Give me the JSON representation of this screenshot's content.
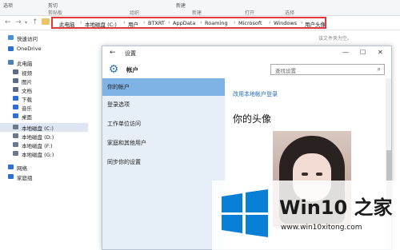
{
  "ribbon": {
    "items": [
      "选项",
      "剪切",
      "组织",
      "新建",
      "打开",
      "选择"
    ],
    "labels": [
      "剪贴板",
      "组织",
      "新建",
      "打开",
      "选择"
    ]
  },
  "address": {
    "crumbs": [
      "此电脑",
      "本地磁盘 (C:)",
      "用户",
      "BTXRT",
      "AppData",
      "Roaming",
      "Microsoft",
      "Windows",
      "用户头像"
    ]
  },
  "explorer": {
    "search_hint": "该文件夹为空。",
    "sidebar": [
      {
        "label": "快速访问",
        "icon": "star-icon",
        "color": "#4a90d9"
      },
      {
        "label": "OneDrive",
        "icon": "cloud-icon",
        "color": "#2e6fd1"
      },
      {
        "label": "此电脑",
        "icon": "computer-icon",
        "color": "#4a7fb5"
      },
      {
        "label": "视频",
        "icon": "video-folder-icon",
        "color": "#5a6d84"
      },
      {
        "label": "图片",
        "icon": "pictures-folder-icon",
        "color": "#5a6d84"
      },
      {
        "label": "文档",
        "icon": "documents-folder-icon",
        "color": "#5a6d84"
      },
      {
        "label": "下载",
        "icon": "download-icon",
        "color": "#2e6fd1"
      },
      {
        "label": "音乐",
        "icon": "music-icon",
        "color": "#2e6fd1"
      },
      {
        "label": "桌面",
        "icon": "desktop-folder-icon",
        "color": "#2e6fd1"
      },
      {
        "label": "本地磁盘 (C:)",
        "icon": "drive-icon",
        "color": "#6b7a8a",
        "selected": true
      },
      {
        "label": "本地磁盘 (D:)",
        "icon": "drive-icon",
        "color": "#6b7a8a"
      },
      {
        "label": "本地磁盘 (F:)",
        "icon": "drive-icon",
        "color": "#6b7a8a"
      },
      {
        "label": "本地磁盘 (G:)",
        "icon": "drive-icon",
        "color": "#6b7a8a"
      },
      {
        "label": "网络",
        "icon": "network-icon",
        "color": "#2e6fd1"
      },
      {
        "label": "家庭组",
        "icon": "homegroup-icon",
        "color": "#2e6fd1"
      }
    ]
  },
  "settings": {
    "title": "设置",
    "header": "帐户",
    "search_placeholder": "查找设置",
    "nav": [
      "你的帐户",
      "登录选项",
      "工作单位访问",
      "家庭和其他用户",
      "同步你的设置"
    ],
    "link": "改用本地帐户登录",
    "avatar_heading": "你的头像"
  },
  "watermark": {
    "brand": "Win10 之家",
    "url": "www.win10xitong.com"
  },
  "colors": {
    "accent": "#1f6bbf",
    "highlight_box": "#e0383e",
    "nav_selected": "#7fb3e6"
  }
}
